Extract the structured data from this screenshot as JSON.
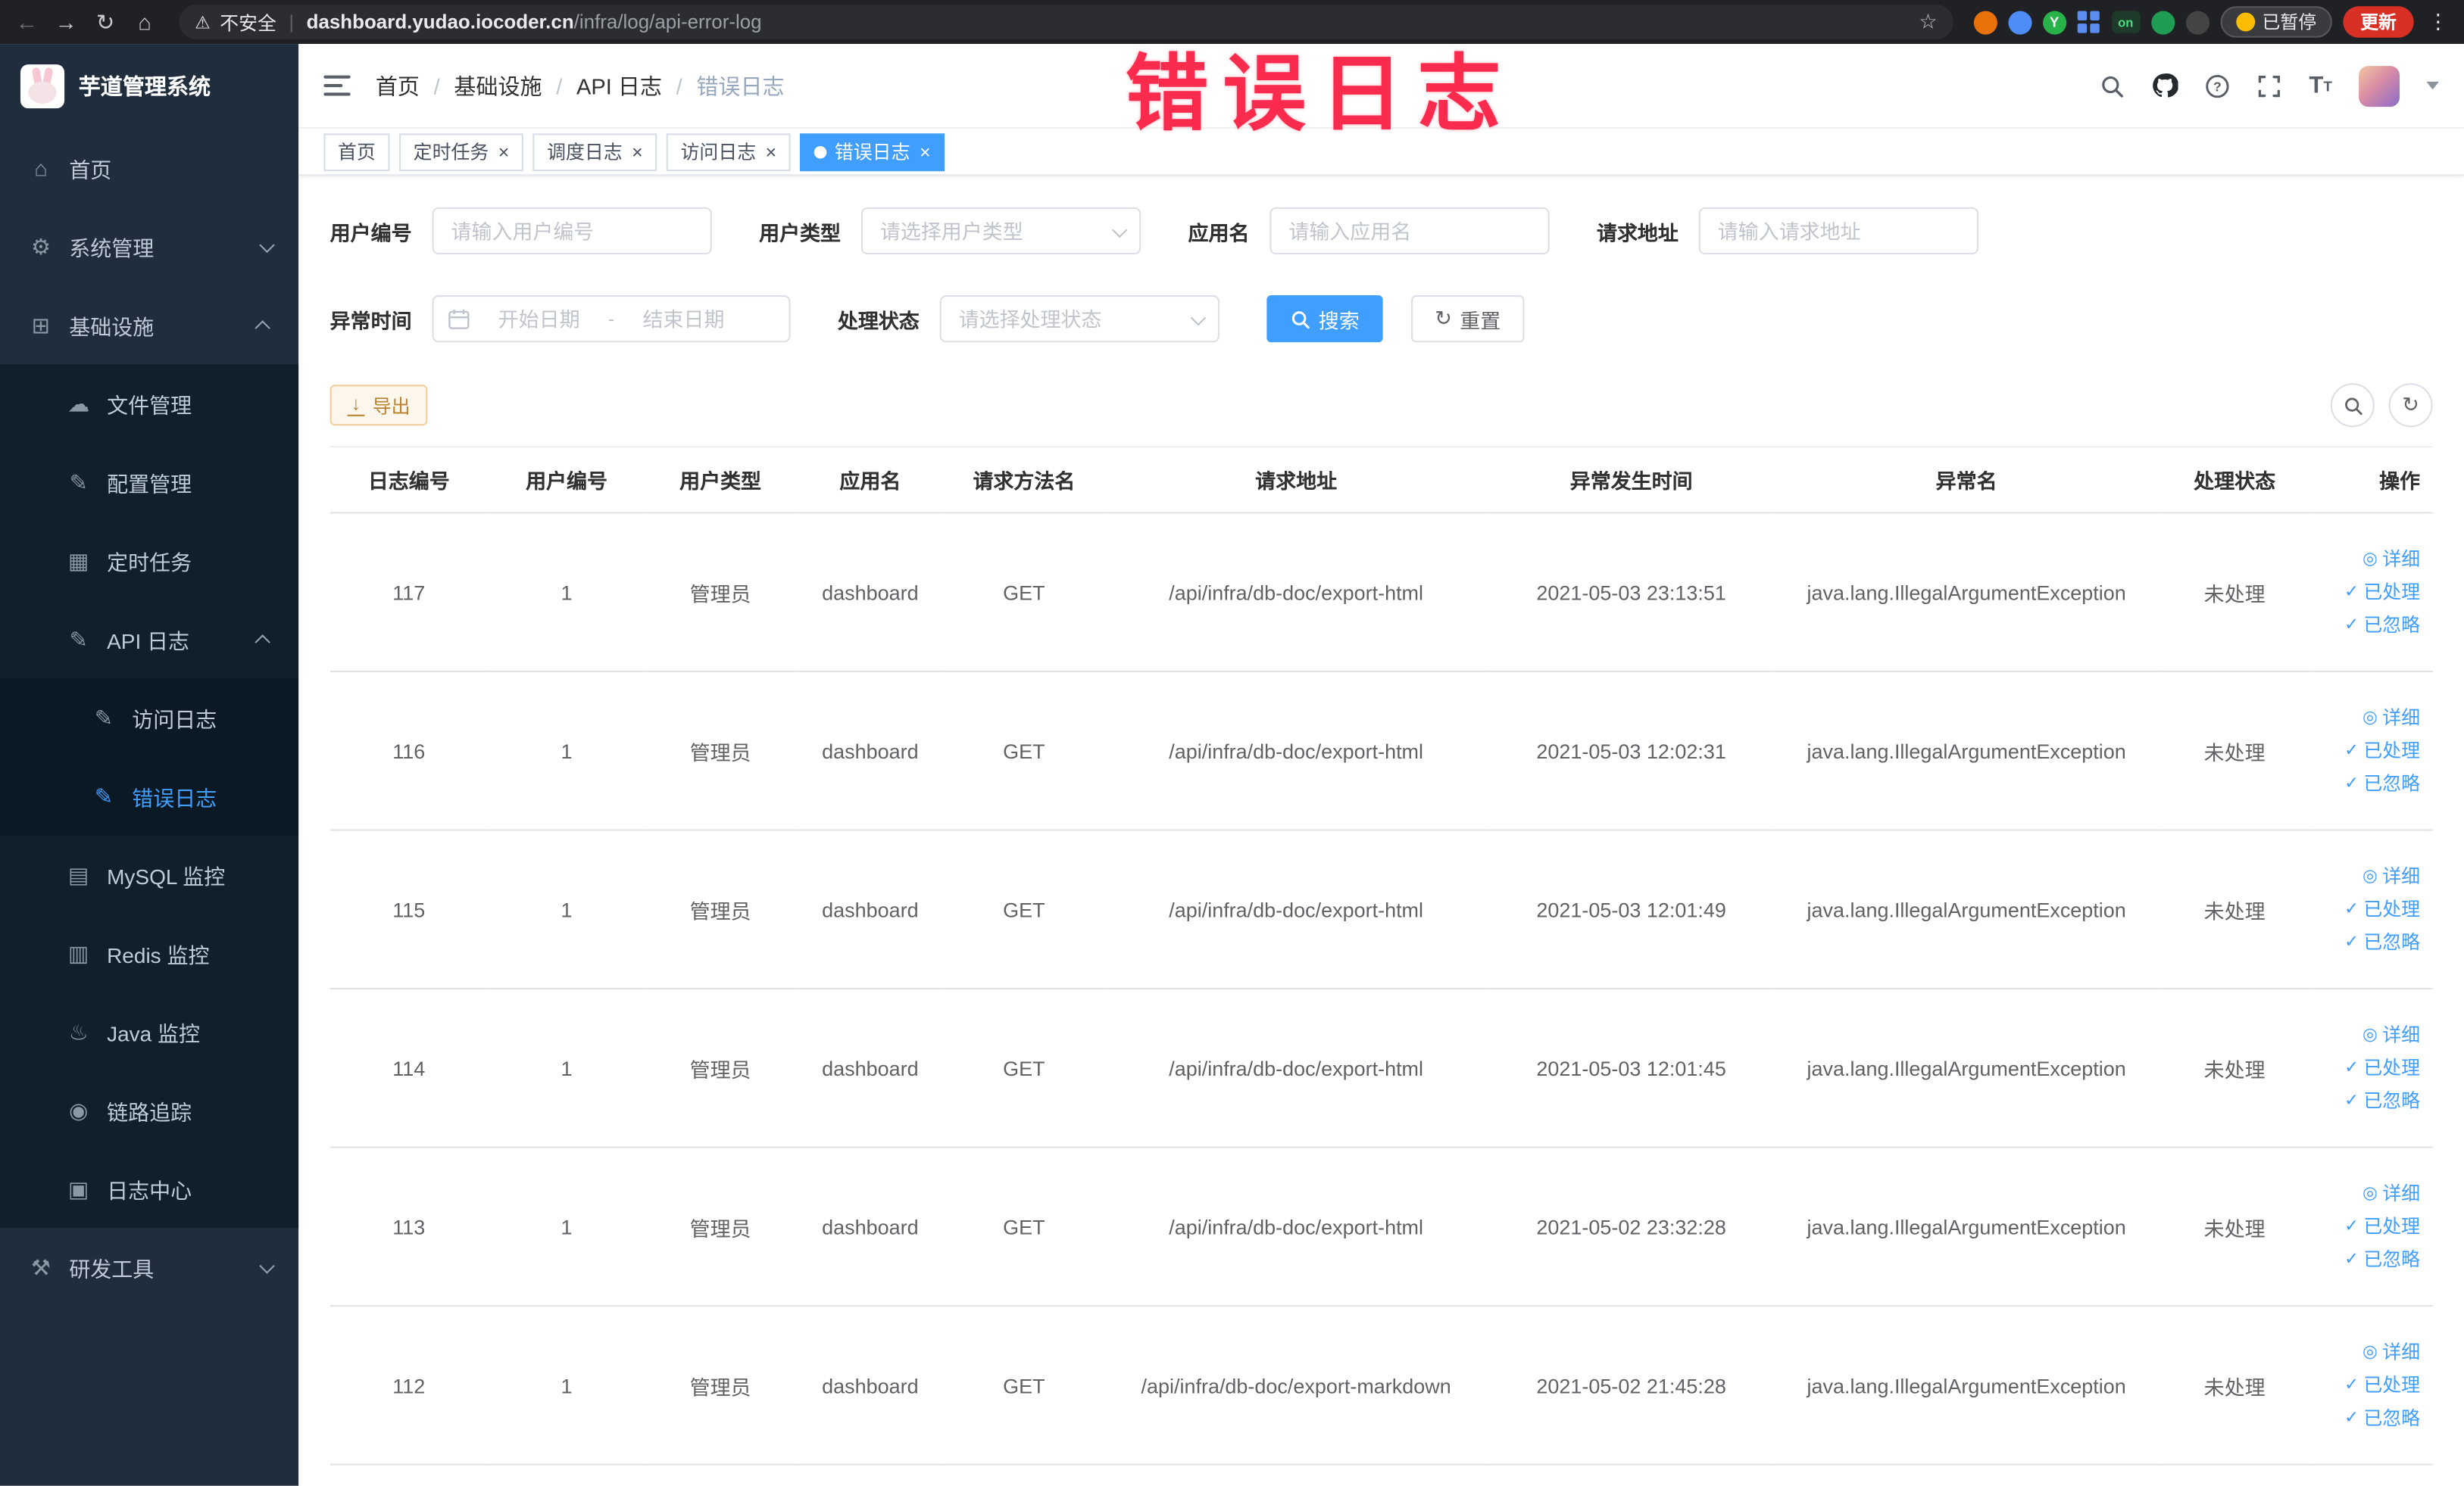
{
  "browser": {
    "security_label": "不安全",
    "url_host": "dashboard.yudao.iocoder.cn",
    "url_path": "/infra/log/api-error-log",
    "paused_label": "已暂停",
    "update_label": "更新",
    "extension_badge_on": "on",
    "green_ext_letter": "Y"
  },
  "annotation": {
    "text": "错误日志",
    "color": "#fb2b4e"
  },
  "sidebar": {
    "logo_title": "芋道管理系统",
    "menu": [
      {
        "key": "home",
        "label": "首页",
        "icon": "home-icon",
        "level": 1
      },
      {
        "key": "system-management",
        "label": "系统管理",
        "icon": "gear-icon",
        "level": 1,
        "chevron": "down"
      },
      {
        "key": "infrastructure",
        "label": "基础设施",
        "icon": "infrastructure-icon",
        "level": 1,
        "chevron": "up"
      },
      {
        "key": "file-management",
        "label": "文件管理",
        "icon": "cloud-icon",
        "level": 2
      },
      {
        "key": "config-management",
        "label": "配置管理",
        "icon": "edit-icon",
        "level": 2
      },
      {
        "key": "scheduled-jobs",
        "label": "定时任务",
        "icon": "job-icon",
        "level": 2
      },
      {
        "key": "api-log",
        "label": "API 日志",
        "icon": "log-icon",
        "level": 2,
        "chevron": "up"
      },
      {
        "key": "access-log",
        "label": "访问日志",
        "icon": "document-icon",
        "level": 3
      },
      {
        "key": "error-log",
        "label": "错误日志",
        "icon": "document-icon",
        "level": 3,
        "active": true
      },
      {
        "key": "mysql-monitor",
        "label": "MySQL 监控",
        "icon": "mysql-icon",
        "level": 2
      },
      {
        "key": "redis-monitor",
        "label": "Redis 监控",
        "icon": "redis-icon",
        "level": 2
      },
      {
        "key": "java-monitor",
        "label": "Java 监控",
        "icon": "java-icon",
        "level": 2
      },
      {
        "key": "trace",
        "label": "链路追踪",
        "icon": "trace-icon",
        "level": 2
      },
      {
        "key": "log-center",
        "label": "日志中心",
        "icon": "log-center-icon",
        "level": 2
      },
      {
        "key": "dev-tools",
        "label": "研发工具",
        "icon": "tools-icon",
        "level": 1,
        "chevron": "down"
      }
    ]
  },
  "header": {
    "breadcrumb": [
      "首页",
      "基础设施",
      "API 日志",
      "错误日志"
    ]
  },
  "tabs": [
    {
      "label": "首页",
      "closable": false,
      "active": false
    },
    {
      "label": "定时任务",
      "closable": true,
      "active": false
    },
    {
      "label": "调度日志",
      "closable": true,
      "active": false
    },
    {
      "label": "访问日志",
      "closable": true,
      "active": false
    },
    {
      "label": "错误日志",
      "closable": true,
      "active": true
    }
  ],
  "filters": {
    "user_id": {
      "label": "用户编号",
      "placeholder": "请输入用户编号"
    },
    "user_type": {
      "label": "用户类型",
      "placeholder": "请选择用户类型"
    },
    "app_name": {
      "label": "应用名",
      "placeholder": "请输入应用名"
    },
    "request_url": {
      "label": "请求地址",
      "placeholder": "请输入请求地址"
    },
    "exception_time": {
      "label": "异常时间",
      "start_placeholder": "开始日期",
      "separator": "-",
      "end_placeholder": "结束日期"
    },
    "process_status": {
      "label": "处理状态",
      "placeholder": "请选择处理状态"
    },
    "search_label": "搜索",
    "reset_label": "重置"
  },
  "toolbar": {
    "export_label": "导出"
  },
  "table": {
    "columns": [
      "日志编号",
      "用户编号",
      "用户类型",
      "应用名",
      "请求方法名",
      "请求地址",
      "异常发生时间",
      "异常名",
      "处理状态",
      "操作"
    ],
    "rows": [
      {
        "id": "117",
        "user_id": "1",
        "user_type": "管理员",
        "app": "dashboard",
        "method": "GET",
        "url": "/api/infra/db-doc/export-html",
        "time": "2021-05-03 23:13:51",
        "exception": "java.lang.IllegalArgumentException",
        "status": "未处理"
      },
      {
        "id": "116",
        "user_id": "1",
        "user_type": "管理员",
        "app": "dashboard",
        "method": "GET",
        "url": "/api/infra/db-doc/export-html",
        "time": "2021-05-03 12:02:31",
        "exception": "java.lang.IllegalArgumentException",
        "status": "未处理"
      },
      {
        "id": "115",
        "user_id": "1",
        "user_type": "管理员",
        "app": "dashboard",
        "method": "GET",
        "url": "/api/infra/db-doc/export-html",
        "time": "2021-05-03 12:01:49",
        "exception": "java.lang.IllegalArgumentException",
        "status": "未处理"
      },
      {
        "id": "114",
        "user_id": "1",
        "user_type": "管理员",
        "app": "dashboard",
        "method": "GET",
        "url": "/api/infra/db-doc/export-html",
        "time": "2021-05-03 12:01:45",
        "exception": "java.lang.IllegalArgumentException",
        "status": "未处理"
      },
      {
        "id": "113",
        "user_id": "1",
        "user_type": "管理员",
        "app": "dashboard",
        "method": "GET",
        "url": "/api/infra/db-doc/export-html",
        "time": "2021-05-02 23:32:28",
        "exception": "java.lang.IllegalArgumentException",
        "status": "未处理"
      },
      {
        "id": "112",
        "user_id": "1",
        "user_type": "管理员",
        "app": "dashboard",
        "method": "GET",
        "url": "/api/infra/db-doc/export-markdown",
        "time": "2021-05-02 21:45:28",
        "exception": "java.lang.IllegalArgumentException",
        "status": "未处理"
      }
    ],
    "actions": {
      "detail": "详细",
      "processed": "已处理",
      "ignored": "已忽略"
    }
  },
  "colors": {
    "primary": "#409eff",
    "warning": "#e6a23c",
    "sidebar_bg": "#1f2d3d",
    "annotation": "#fb2b4e"
  }
}
